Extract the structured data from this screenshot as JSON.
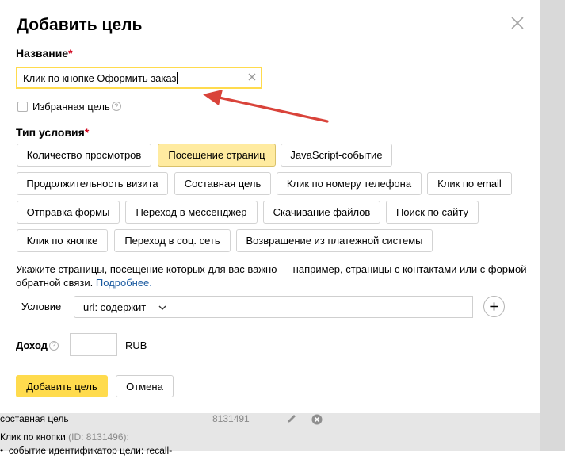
{
  "modal": {
    "title": "Добавить цель",
    "name_label": "Название",
    "required_mark": "*",
    "name_value": "Клик по кнопке Оформить заказ",
    "favorite_label": "Избранная цель",
    "help_glyph": "?",
    "condition_type_label": "Тип условия",
    "condition_types": [
      "Количество просмотров",
      "Посещение страниц",
      "JavaScript-событие",
      "Продолжительность визита",
      "Составная цель",
      "Клик по номеру телефона",
      "Клик по email",
      "Отправка формы",
      "Переход в мессенджер",
      "Скачивание файлов",
      "Поиск по сайту",
      "Клик по кнопке",
      "Переход в соц. сеть",
      "Возвращение из платежной системы"
    ],
    "active_condition_type": "Посещение страниц",
    "description_text": "Укажите страницы, посещение которых для вас важно — например, страницы с контактами или с формой обратной связи.",
    "description_link": "Подробнее.",
    "condition_label": "Условие",
    "condition_select_value": "url: содержит",
    "income_label": "Доход",
    "currency": "RUB",
    "submit_label": "Добавить цель",
    "cancel_label": "Отмена"
  },
  "background": {
    "row1_label": "составная цель",
    "row1_id": "8131491",
    "row2_title": "Клик по кнопки",
    "row2_id": "(ID: 8131496):",
    "row3_text": "событие идентификатор цели: recall-"
  },
  "icons": {
    "close": "close-icon",
    "clear": "clear-icon",
    "chevron": "chevron-down-icon",
    "plus": "plus-icon",
    "edit": "pencil-icon",
    "delete": "delete-circle-icon",
    "annotation": "red-arrow"
  },
  "colors": {
    "accent": "#ffdb4d",
    "active_chip": "#ffeba0",
    "required": "#d0021b",
    "link": "#1a5aa0",
    "annotation_arrow": "#d9433a"
  }
}
